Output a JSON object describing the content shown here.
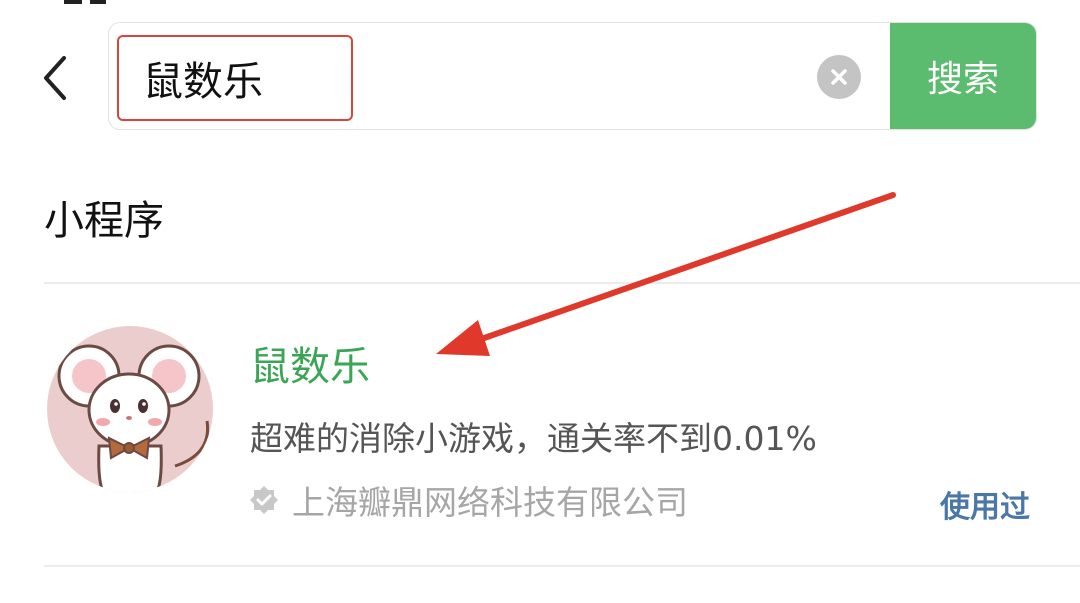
{
  "search": {
    "query": "鼠数乐",
    "button_label": "搜索"
  },
  "section": {
    "title": "小程序"
  },
  "result": {
    "name": "鼠数乐",
    "description": "超难的消除小游戏，通关率不到0.01%",
    "company": "上海瓣鼎网络科技有限公司",
    "used_tag": "使用过"
  },
  "colors": {
    "search_button": "#5bbb6f",
    "result_name": "#3aa655",
    "highlight_border": "#d9453b",
    "annotation_arrow": "#e0392b",
    "used_tag": "#4a77a8"
  },
  "icons": {
    "back": "chevron-left-icon",
    "clear": "clear-icon",
    "verified": "verified-badge-icon"
  }
}
